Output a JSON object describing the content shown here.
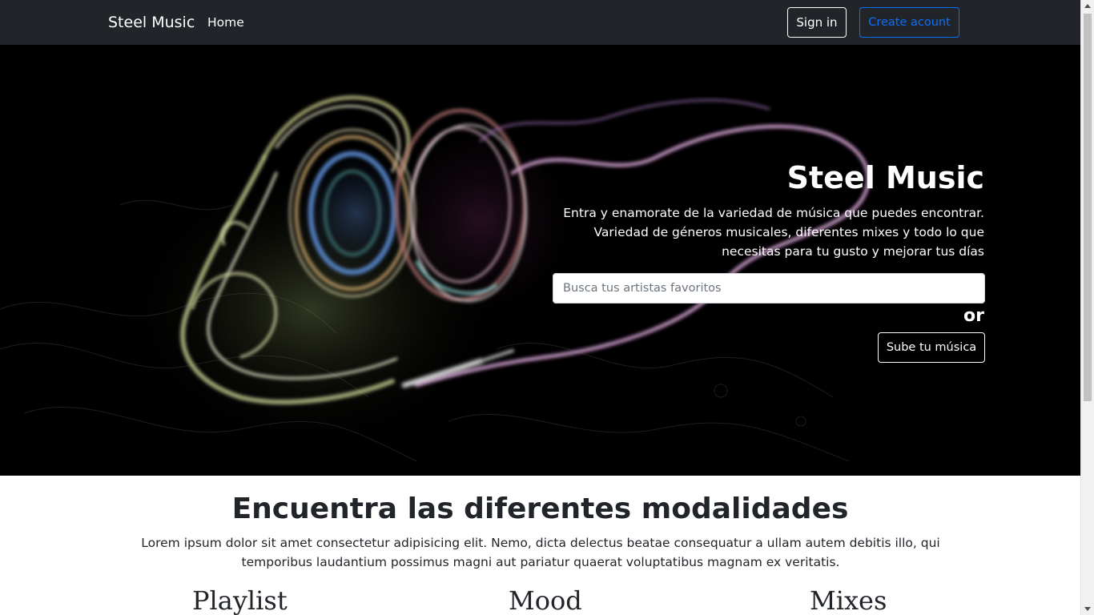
{
  "navbar": {
    "brand": "Steel Music",
    "home_label": "Home",
    "signin_label": "Sign in",
    "create_account_label": "Create acount"
  },
  "hero": {
    "title": "Steel Music",
    "description": "Entra y enamorate de la variedad de música que puedes encontrar. Variedad de géneros musicales, diferentes mixes y todo lo que necesitas para tu gusto y mejorar tus días",
    "search_placeholder": "Busca tus artistas favoritos",
    "search_value": "",
    "or_label": "or",
    "upload_label": "Sube tu música",
    "background_image": "neon-headphones"
  },
  "section": {
    "title": "Encuentra las diferentes modalidades",
    "text": "Lorem ipsum dolor sit amet consectetur adipisicing elit. Nemo, dicta delectus beatae consequatur a ullam autem debitis illo, qui temporibus laudantium possimus magni aut pariatur quaerat voluptatibus magnam ex veritatis.",
    "cards": [
      {
        "title": "Playlist"
      },
      {
        "title": "Mood"
      },
      {
        "title": "Mixes"
      }
    ]
  },
  "colors": {
    "navbar_bg": "#212529",
    "hero_bg": "#000000",
    "primary": "#0d6efd",
    "text_dark": "#212529"
  }
}
